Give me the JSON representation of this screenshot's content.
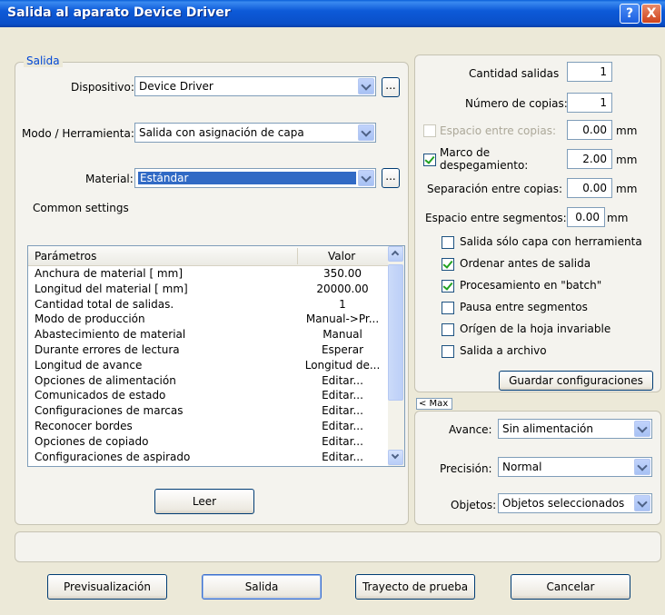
{
  "window": {
    "title": "Salida al aparato Device Driver",
    "help": "?",
    "close": "X"
  },
  "salida": {
    "legend": "Salida",
    "dispositivo_label": "Dispositivo:",
    "dispositivo_value": "Device Driver",
    "modo_label": "Modo / Herramienta:",
    "modo_value": "Salida con asignación de capa",
    "material_label": "Material:",
    "material_value": "Estándar",
    "ellipsis": "...",
    "common_settings": "Common settings",
    "leer_button": "Leer"
  },
  "table": {
    "col_param": "Parámetros",
    "col_valor": "Valor",
    "rows": [
      {
        "param": "Anchura de material [ mm]",
        "valor": "350.00"
      },
      {
        "param": "Longitud del material [ mm]",
        "valor": "20000.00"
      },
      {
        "param": "Cantidad total de salidas.",
        "valor": "1"
      },
      {
        "param": "Modo de producción",
        "valor": "Manual->Pr..."
      },
      {
        "param": "Abastecimiento de material",
        "valor": "Manual"
      },
      {
        "param": "Durante errores de lectura",
        "valor": "Esperar"
      },
      {
        "param": "Longitud de avance",
        "valor": "Longitud de..."
      },
      {
        "param": "Opciones de alimentación",
        "valor": "Editar..."
      },
      {
        "param": "Comunicados de estado",
        "valor": "Editar..."
      },
      {
        "param": "Configuraciones de marcas",
        "valor": "Editar..."
      },
      {
        "param": "Reconocer bordes",
        "valor": "Editar..."
      },
      {
        "param": "Opciones de copiado",
        "valor": "Editar..."
      },
      {
        "param": "Configuraciones de aspirado",
        "valor": "Editar..."
      }
    ]
  },
  "right": {
    "cantidad_label": "Cantidad salidas",
    "cantidad_value": "1",
    "copias_label": "Número de copias:",
    "copias_value": "1",
    "espacio_label": "Espacio entre copias:",
    "espacio_value": "0.00",
    "marco_label_1": "Marco de",
    "marco_label_2": "despegamiento:",
    "marco_value": "2.00",
    "separacion_label": "Separación entre copias:",
    "separacion_value": "0.00",
    "segmentos_label": "Espacio entre segmentos:",
    "segmentos_value": "0.00",
    "unit": "mm",
    "checks": [
      {
        "label": "Salida sólo capa con herramienta",
        "checked": false
      },
      {
        "label": "Ordenar antes de salida",
        "checked": true
      },
      {
        "label": "Procesamiento en \"batch\"",
        "checked": true
      },
      {
        "label": "Pausa entre segmentos",
        "checked": false
      },
      {
        "label": "Orígen de la hoja invariable",
        "checked": false
      },
      {
        "label": "Salida a archivo",
        "checked": false
      }
    ],
    "guardar_button": "Guardar configuraciones",
    "max_toggle": "< Max",
    "avance_label": "Avance:",
    "avance_value": "Sin alimentación",
    "precision_label": "Precisión:",
    "precision_value": "Normal",
    "objetos_label": "Objetos:",
    "objetos_value": "Objetos seleccionados"
  },
  "bottom": {
    "previsualizacion": "Previsualización",
    "salida": "Salida",
    "trayecto": "Trayecto de prueba",
    "cancelar": "Cancelar"
  }
}
